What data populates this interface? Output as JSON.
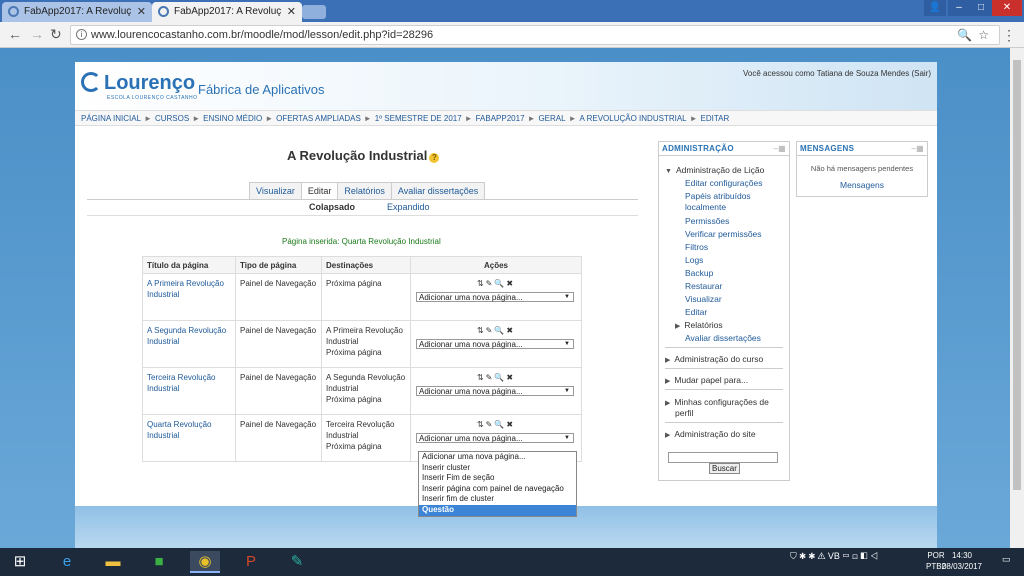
{
  "browser": {
    "tabs": [
      {
        "title": "FabApp2017: A Revoluç",
        "active": false
      },
      {
        "title": "FabApp2017: A Revoluç",
        "active": true
      }
    ],
    "url": "www.lourencocastanho.com.br/moodle/mod/lesson/edit.php?id=28296",
    "window_controls": [
      "–",
      "□",
      "✕"
    ]
  },
  "header": {
    "logo_text": "Lourenço",
    "logo_sub": "ESCOLA LOURENÇO CASTANHO",
    "site_title": "Fábrica de Aplicativos",
    "login_info": "Você acessou como Tatiana de Souza Mendes (Sair)"
  },
  "breadcrumb": [
    "PÁGINA INICIAL",
    "CURSOS",
    "ENSINO MÉDIO",
    "OFERTAS AMPLIADAS",
    "1º SEMESTRE DE 2017",
    "FABAPP2017",
    "GERAL",
    "A REVOLUÇÃO INDUSTRIAL",
    "EDITAR"
  ],
  "main": {
    "title": "A Revolução Industrial",
    "tabs": [
      "Visualizar",
      "Editar",
      "Relatórios",
      "Avaliar dissertações"
    ],
    "subtabs": {
      "collapsed": "Colapsado",
      "expanded": "Expandido"
    },
    "notice": "Página inserida: Quarta Revolução Industrial",
    "table_headers": [
      "Título da página",
      "Tipo de página",
      "Destinações",
      "Ações"
    ],
    "rows": [
      {
        "title": "A Primeira Revolução Industrial",
        "type": "Painel de Navegação",
        "dest1": "Próxima página",
        "dest2": "",
        "select": "Adicionar uma nova página..."
      },
      {
        "title": "A Segunda Revolução Industrial",
        "type": "Painel de Navegação",
        "dest1": "A Primeira Revolução Industrial",
        "dest2": "Próxima página",
        "select": "Adicionar uma nova página..."
      },
      {
        "title": "Terceira Revolução Industrial",
        "type": "Painel de Navegação",
        "dest1": "A Segunda Revolução Industrial",
        "dest2": "Próxima página",
        "select": "Adicionar uma nova página..."
      },
      {
        "title": "Quarta Revolução Industrial",
        "type": "Painel de Navegação",
        "dest1": "Terceira Revolução Industrial",
        "dest2": "Próxima página",
        "select": "Adicionar uma nova página..."
      }
    ],
    "dropdown_options": [
      "Adicionar uma nova página...",
      "Inserir cluster",
      "Inserir Fim de seção",
      "Inserir página com painel de navegação",
      "Inserir fim de cluster",
      "Questão"
    ]
  },
  "admin_block": {
    "title": "ADMINISTRAÇÃO",
    "lesson_admin": "Administração de Lição",
    "lesson_items": [
      "Editar configurações",
      "Papéis atribuídos",
      "localmente",
      "Permissões",
      "Verificar permissões",
      "Filtros",
      "Logs",
      "Backup",
      "Restaurar",
      "Visualizar",
      "Editar",
      "Relatórios",
      "Avaliar dissertações"
    ],
    "course_admin": "Administração do curso",
    "change_role": "Mudar papel para...",
    "profile_settings_1": "Minhas configurações de",
    "profile_settings_2": "perfil",
    "site_admin": "Administração do site",
    "search_button": "Buscar"
  },
  "messages_block": {
    "title": "MENSAGENS",
    "none": "Não há mensagens pendentes",
    "link": "Mensagens"
  },
  "taskbar": {
    "lang1": "POR",
    "lang2": "PTB2",
    "time": "14:30",
    "date": "08/03/2017"
  }
}
